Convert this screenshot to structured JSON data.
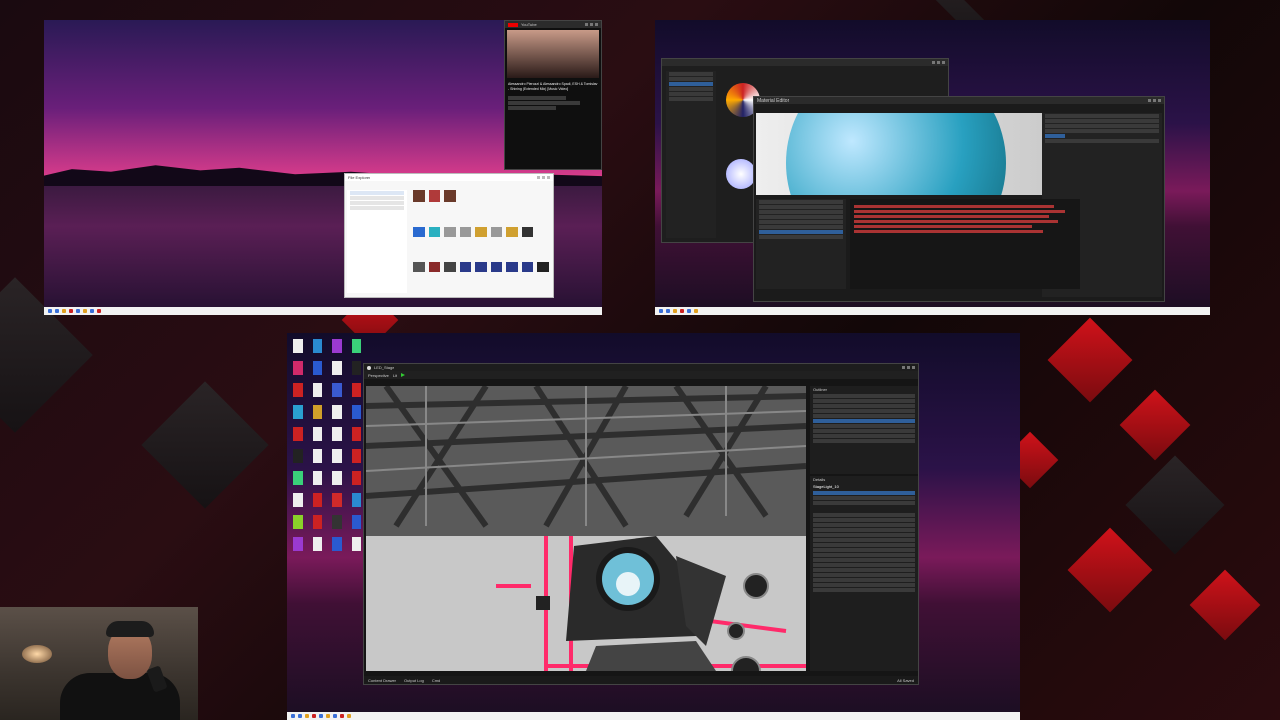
{
  "screens": {
    "top_left": {
      "browser": {
        "site": "YouTube",
        "video_title": "Alessandro Pierozzi & Alessandro Spadi, ESH & Tomislav - Shining (Extended Mix) [Music Video]"
      },
      "explorer": {
        "title": "File Explorer"
      }
    },
    "top_right": {
      "editor": {
        "title": "Material Editor"
      }
    },
    "bottom": {
      "unreal": {
        "project": "LED_Stage",
        "viewport_mode": "Perspective",
        "lit_mode": "Lit",
        "outliner_title": "Outliner",
        "details_title": "Details",
        "selected_actor": "StageLight_10",
        "bottom_tabs": [
          "Content Drawer",
          "Output Log",
          "Cmd"
        ],
        "status": "All Saved"
      }
    }
  },
  "colors": {
    "accent_red": "#d0121a",
    "taskbar": "#f2f2f2",
    "selection": "#2f5f9a",
    "stage_pink": "#ff2a6a"
  }
}
